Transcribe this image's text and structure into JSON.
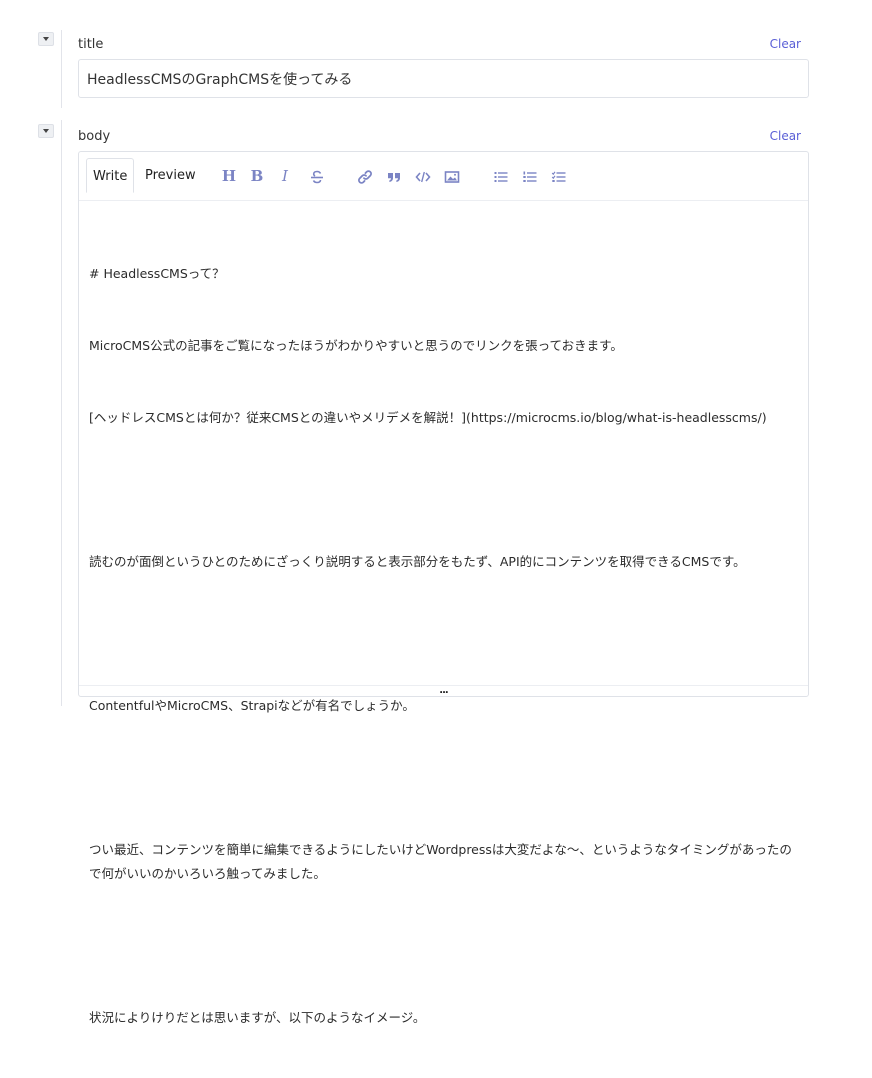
{
  "fields": {
    "title": {
      "label": "title",
      "clear_label": "Clear",
      "value": "HeadlessCMSのGraphCMSを使ってみる"
    },
    "body": {
      "label": "body",
      "clear_label": "Clear",
      "tabs": [
        "Write",
        "Preview"
      ],
      "active_tab": "Write",
      "toolbar_icons": [
        "heading-icon",
        "bold-icon",
        "italic-icon",
        "strikethrough-icon",
        "link-icon",
        "quote-icon",
        "code-icon",
        "image-icon",
        "bulleted-list-icon",
        "numbered-list-icon",
        "task-list-icon"
      ],
      "toolbar_text": {
        "heading": "H",
        "bold": "B",
        "italic": "I"
      },
      "lines": [
        "# HeadlessCMSって？",
        "MicroCMS公式の記事をご覧になったほうがわかりやすいと思うのでリンクを張っておきます。",
        "[ヘッドレスCMSとは何か？従来CMSとの違いやメリデメを解説！](https://microcms.io/blog/what-is-headlesscms/)",
        "",
        "読むのが面倒というひとのためにざっくり説明すると表示部分をもたず、API的にコンテンツを取得できるCMSです。",
        "",
        "ContentfulやMicroCMS、Strapiなどが有名でしょうか。",
        "",
        "つい最近、コンテンツを簡単に編集できるようにしたいけどWordpressは大変だよな～、というようなタイミングがあったので何がいいのかいろいろ触ってみました。",
        "",
        "状況によりけりだとは思いますが、以下のようなイメージ。"
      ],
      "resize_handle": "..."
    }
  },
  "colors": {
    "accent": "#5a5fd6",
    "icon": "#7b84c4",
    "border": "#dfe2e8"
  }
}
